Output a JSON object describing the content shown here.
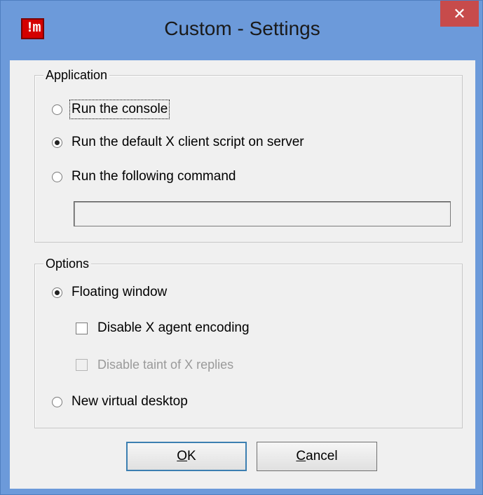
{
  "window": {
    "title": "Custom - Settings",
    "icon_text": "!m",
    "close_glyph": "✕"
  },
  "application": {
    "group_label": "Application",
    "options": [
      {
        "label": "Run the console",
        "checked": false,
        "focused": true
      },
      {
        "label": "Run the default X client script on server",
        "checked": true
      },
      {
        "label": "Run the following command",
        "checked": false
      }
    ],
    "command_value": ""
  },
  "options_group": {
    "group_label": "Options",
    "floating_window": {
      "label": "Floating window",
      "checked": true
    },
    "disable_x_agent_encoding": {
      "label": "Disable X agent encoding",
      "checked": false,
      "enabled": true
    },
    "disable_taint": {
      "label": "Disable taint of X replies",
      "checked": false,
      "enabled": false
    },
    "new_virtual_desktop": {
      "label": "New virtual desktop",
      "checked": false
    }
  },
  "buttons": {
    "ok_mnemonic": "O",
    "ok_rest": "K",
    "cancel_mnemonic": "C",
    "cancel_rest": "ancel"
  }
}
